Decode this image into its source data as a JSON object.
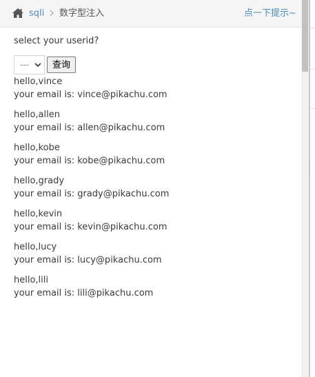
{
  "breadcrumb": {
    "home_label": "sqli",
    "current": "数字型注入",
    "hint_link": "点一下提示~"
  },
  "form": {
    "prompt": "select your userid?",
    "select_value": "---",
    "submit_label": "查询"
  },
  "results": [
    {
      "hello": "hello,vince",
      "email": "your email is: vince@pikachu.com"
    },
    {
      "hello": "hello,allen",
      "email": "your email is: allen@pikachu.com"
    },
    {
      "hello": "hello,kobe",
      "email": "your email is: kobe@pikachu.com"
    },
    {
      "hello": "hello,grady",
      "email": "your email is: grady@pikachu.com"
    },
    {
      "hello": "hello,kevin",
      "email": "your email is: kevin@pikachu.com"
    },
    {
      "hello": "hello,lucy",
      "email": "your email is: lucy@pikachu.com"
    },
    {
      "hello": "hello,lili",
      "email": "your email is: lili@pikachu.com"
    }
  ],
  "icons": {
    "home": "home-icon",
    "separator": "chevron-right-icon",
    "select_arrow": "chevron-down-icon"
  },
  "colors": {
    "link": "#4c8fbd",
    "breadcrumb_bg": "#f5f5f5",
    "text": "#393939"
  }
}
